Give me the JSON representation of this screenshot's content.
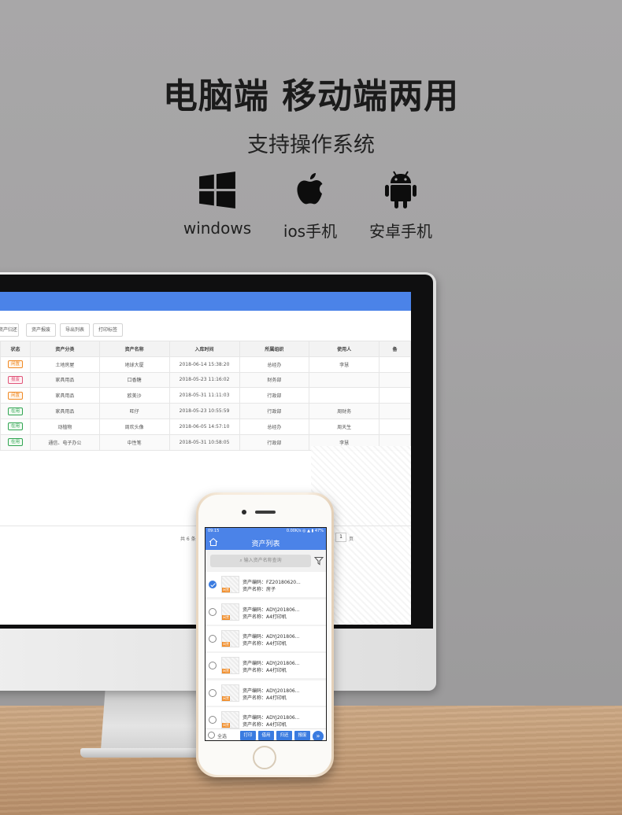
{
  "hero": {
    "title": "电脑端 移动端两用",
    "subtitle": "支持操作系统",
    "os": [
      {
        "label": "windows",
        "icon": "windows-icon"
      },
      {
        "label": "ios手机",
        "icon": "apple-icon"
      },
      {
        "label": "安卓手机",
        "icon": "android-icon"
      }
    ]
  },
  "desktop": {
    "toolbar": [
      "资产归还",
      "资产报废",
      "导出列表",
      "打印标签"
    ],
    "columns": [
      "状态",
      "资产分类",
      "资产名称",
      "入库时间",
      "所属组织",
      "使用人",
      "备"
    ],
    "rows": [
      {
        "status": "闲置",
        "status_color": "#f08a24",
        "category": "土地房屋",
        "name": "地球大厦",
        "time": "2018-06-14 15:38:20",
        "org": "总经办",
        "user": "李慧"
      },
      {
        "status": "报废",
        "status_color": "#e0557a",
        "category": "家具用品",
        "name": "口香糖",
        "time": "2018-05-23 11:16:02",
        "org": "财务部",
        "user": ""
      },
      {
        "status": "闲置",
        "status_color": "#f08a24",
        "category": "家具用品",
        "name": "欧美沙",
        "time": "2018-05-31 11:11:03",
        "org": "行政部",
        "user": ""
      },
      {
        "status": "在用",
        "status_color": "#31a552",
        "category": "家具用品",
        "name": "旺仔",
        "time": "2018-05-23 10:55:59",
        "org": "行政部",
        "user": "周财务"
      },
      {
        "status": "在用",
        "status_color": "#31a552",
        "category": "动植物",
        "name": "周欢头像",
        "time": "2018-06-05 14:57:10",
        "org": "总经办",
        "user": "周天生"
      },
      {
        "status": "在用",
        "status_color": "#31a552",
        "category": "通信、电子办公",
        "name": "中性笔",
        "time": "2018-05-31 10:58:05",
        "org": "行政部",
        "user": "李慧"
      }
    ],
    "pager": {
      "total_text": "共 6 条",
      "page": "1",
      "unit": "页"
    }
  },
  "mobile": {
    "status_time": "09:15",
    "status_info": "0.00K/s ◎ ▲ ▮ 47%",
    "title": "资产列表",
    "search_placeholder": "输入资产名称查询",
    "items": [
      {
        "code": "资产编码：FZ20180620...",
        "name": "资产名称：房子",
        "tag": "闲置",
        "checked": true
      },
      {
        "code": "资产编码：ADYJ201806...",
        "name": "资产名称：A4打印机",
        "tag": "闲置",
        "checked": false
      },
      {
        "code": "资产编码：ADYJ201806...",
        "name": "资产名称：A4打印机",
        "tag": "闲置",
        "checked": false
      },
      {
        "code": "资产编码：ADYJ201806...",
        "name": "资产名称：A4打印机",
        "tag": "闲置",
        "checked": false
      },
      {
        "code": "资产编码：ADYJ201806...",
        "name": "资产名称：A4打印机",
        "tag": "闲置",
        "checked": false
      },
      {
        "code": "资产编码：ADYJ201806...",
        "name": "资产名称：A4打印机",
        "tag": "闲置",
        "checked": false
      }
    ],
    "select_all": "全选",
    "actions": [
      "打印",
      "借用",
      "归还",
      "报废"
    ],
    "more": "»"
  }
}
